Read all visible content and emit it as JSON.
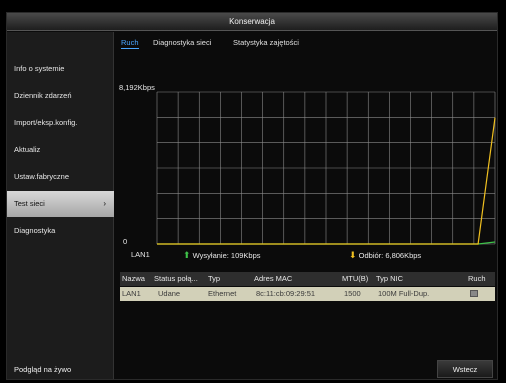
{
  "window": {
    "title": "Konserwacja"
  },
  "sidebar": {
    "items": [
      {
        "label": "Info o systemie"
      },
      {
        "label": "Dziennik zdarzeń"
      },
      {
        "label": "Import/eksp.konfig."
      },
      {
        "label": "Aktualiz"
      },
      {
        "label": "Ustaw.fabryczne"
      },
      {
        "label": "Test sieci",
        "active": true,
        "chevron": "›"
      },
      {
        "label": "Diagnostyka"
      }
    ],
    "bottom_button": "Podgląd na żywo"
  },
  "tabs": [
    {
      "label": "Ruch",
      "active": true
    },
    {
      "label": "Diagnostyka sieci"
    },
    {
      "label": "Statystyka zajętości"
    }
  ],
  "chart": {
    "y_max_label": "8,192Kbps",
    "y_min_label": "0",
    "interface_label": "LAN1",
    "send_label": "Wysyłanie: 109Kbps",
    "receive_label": "Odbiór: 6,806Kbps",
    "colors": {
      "send": "#3fc24a",
      "receive": "#f0c020",
      "grid": "#8a8a8a"
    }
  },
  "chart_data": {
    "type": "line",
    "ylim": [
      0,
      8192
    ],
    "ylabel": "Kbps",
    "series": [
      {
        "name": "Wysyłanie",
        "values": [
          0,
          0,
          0,
          0,
          0,
          0,
          0,
          0,
          0,
          0,
          0,
          0,
          0,
          0,
          0,
          0,
          0,
          0,
          0,
          0,
          109
        ]
      },
      {
        "name": "Odbiór",
        "values": [
          0,
          0,
          0,
          0,
          0,
          0,
          0,
          0,
          0,
          0,
          0,
          0,
          0,
          0,
          0,
          0,
          0,
          0,
          0,
          0,
          6806
        ]
      }
    ]
  },
  "table": {
    "headers": [
      "Nazwa",
      "Status połą...",
      "Typ",
      "Adres MAC",
      "MTU(B)",
      "Typ NIC",
      "Ruch"
    ],
    "rows": [
      [
        "LAN1",
        "Udane",
        "Ethernet",
        "8c:11:cb:09:29:51",
        "1500",
        "100M Full-Dup.",
        ""
      ]
    ]
  },
  "footer": {
    "back_button": "Wstecz"
  }
}
